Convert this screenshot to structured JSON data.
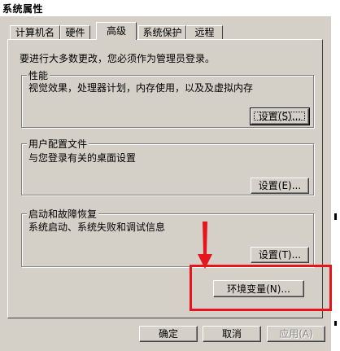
{
  "window": {
    "title": "系统属性"
  },
  "tabs": [
    {
      "label": "计算机名"
    },
    {
      "label": "硬件"
    },
    {
      "label": "高级",
      "active": true
    },
    {
      "label": "系统保护"
    },
    {
      "label": "远程"
    }
  ],
  "admin_note": "要进行大多数更改，您必须作为管理员登录。",
  "groups": {
    "performance": {
      "title": "性能",
      "description": "视觉效果，处理器计划，内存使用，以及及虚拟内存",
      "button": "设置(S)..."
    },
    "user_profile": {
      "title": "用户配置文件",
      "description": "与您登录有关的桌面设置",
      "button": "设置(E)..."
    },
    "startup_recovery": {
      "title": "启动和故障恢复",
      "description": "系统启动、系统失败和调试信息",
      "button": "设置(T)..."
    }
  },
  "env_button": "环境变量(N)...",
  "footer": {
    "ok": "确定",
    "cancel": "取消",
    "apply": "应用(A)"
  },
  "colors": {
    "dialog_bg": "#d4d0c8",
    "highlight_red": "#e8141c"
  }
}
